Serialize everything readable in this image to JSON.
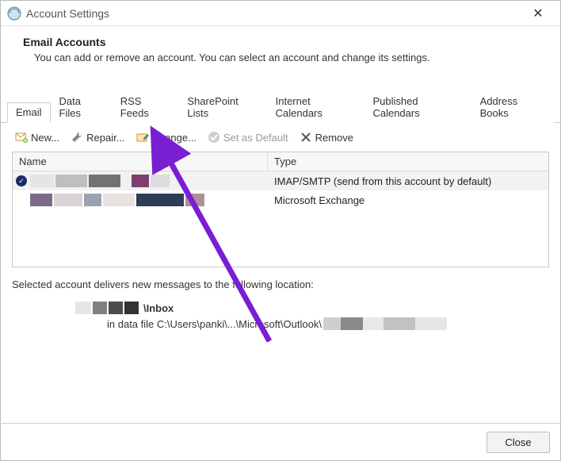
{
  "window": {
    "title": "Account Settings",
    "close_glyph": "✕"
  },
  "header": {
    "title": "Email Accounts",
    "description": "You can add or remove an account. You can select an account and change its settings."
  },
  "tabs": [
    {
      "label": "Email",
      "active": true
    },
    {
      "label": "Data Files"
    },
    {
      "label": "RSS Feeds"
    },
    {
      "label": "SharePoint Lists"
    },
    {
      "label": "Internet Calendars"
    },
    {
      "label": "Published Calendars"
    },
    {
      "label": "Address Books"
    }
  ],
  "toolbar": {
    "new_label": "New...",
    "repair_label": "Repair...",
    "change_label": "Change...",
    "setdefault_label": "Set as Default",
    "remove_label": "Remove"
  },
  "table": {
    "columns": {
      "name": "Name",
      "type": "Type"
    },
    "rows": [
      {
        "default": true,
        "type": "IMAP/SMTP (send from this account by default)"
      },
      {
        "default": false,
        "type": "Microsoft Exchange"
      }
    ]
  },
  "location": {
    "intro": "Selected account delivers new messages to the following location:",
    "folder": "\\Inbox",
    "path_prefix": "in data file C:\\Users\\panki\\...\\Microsoft\\Outlook\\"
  },
  "buttons": {
    "close": "Close"
  },
  "annotation": {
    "color": "#7a1ed2"
  }
}
